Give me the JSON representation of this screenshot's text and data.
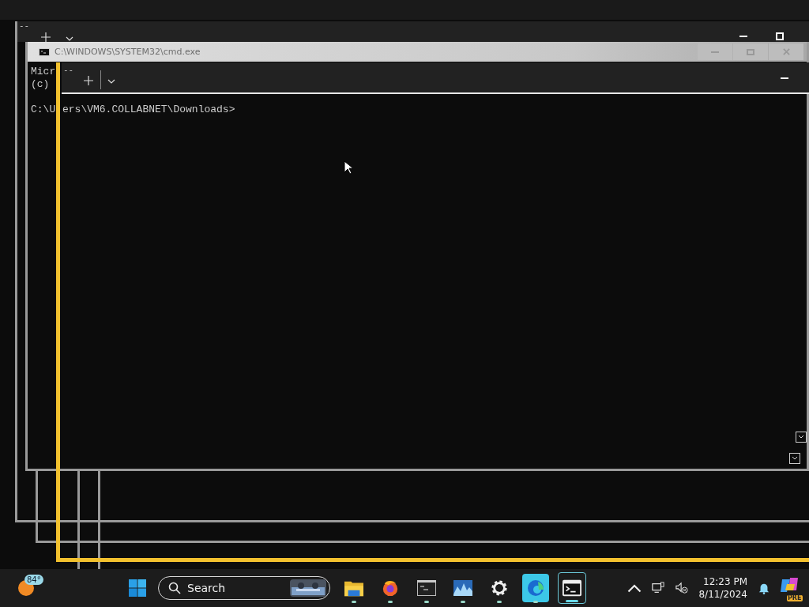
{
  "back_window": {
    "tab_mark": "--"
  },
  "cmd_window": {
    "title": "C:\\WINDOWS\\SYSTEM32\\cmd.exe",
    "active": false,
    "console_lines": [
      "Micr",
      "(c)"
    ],
    "prompt_start": "C:\\U",
    "prompt_rest": "ers\\VM6.COLLABNET\\Downloads>"
  },
  "terminal_window": {
    "tab_mark": "--"
  },
  "taskbar": {
    "weather": {
      "temperature": "84°"
    },
    "search": {
      "placeholder": "Search"
    },
    "apps": [
      {
        "kind": "explorer",
        "running": true,
        "selected": false
      },
      {
        "kind": "firefox",
        "running": true,
        "selected": false
      },
      {
        "kind": "cmd",
        "running": true,
        "selected": false
      },
      {
        "kind": "monitor",
        "running": true,
        "selected": false
      },
      {
        "kind": "settings",
        "running": true,
        "selected": false
      },
      {
        "kind": "edge",
        "running": true,
        "selected": false
      },
      {
        "kind": "terminal",
        "running": true,
        "selected": true
      }
    ],
    "clock": {
      "time": "12:23 PM",
      "date": "8/11/2024"
    },
    "copilot_badge": "PRE"
  }
}
